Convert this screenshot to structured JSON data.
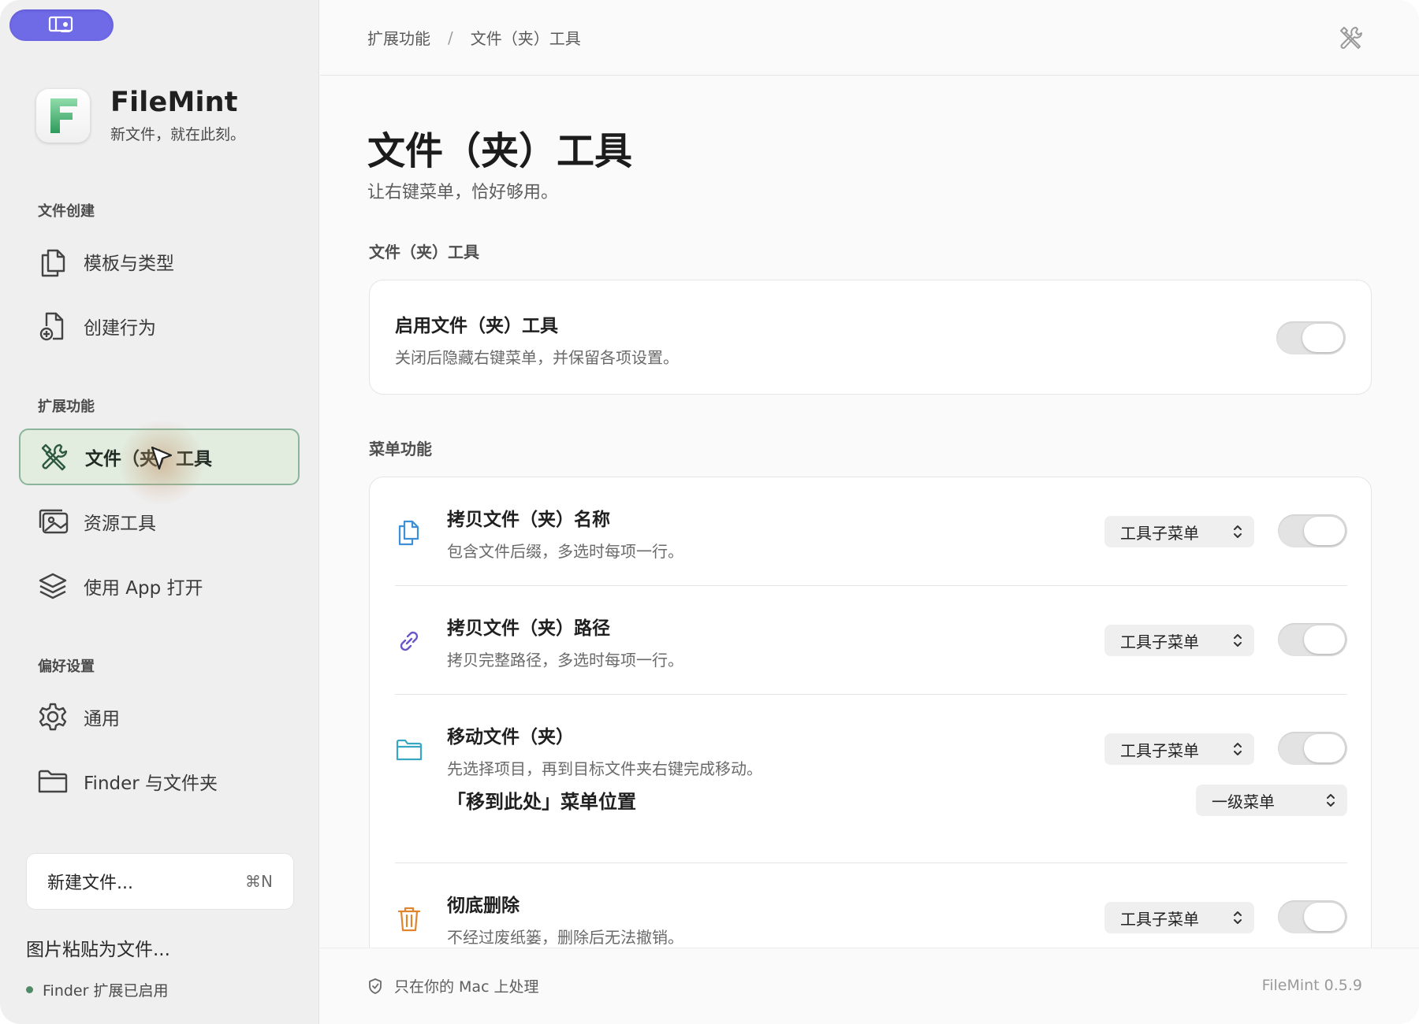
{
  "app": {
    "name": "FileMint",
    "tagline": "新文件，就在此刻。",
    "accent_color": "#6f6ae6",
    "active_color": "#8bb59a"
  },
  "sidebar": {
    "toggle_icon": "sidebar-toggle-icon",
    "sections": [
      {
        "label": "文件创建",
        "items": [
          {
            "label": "模板与类型",
            "icon": "files-icon"
          },
          {
            "label": "创建行为",
            "icon": "file-plus-icon"
          }
        ]
      },
      {
        "label": "扩展功能",
        "items": [
          {
            "label": "文件（夹）工具",
            "icon": "tools-icon",
            "active": true
          },
          {
            "label": "资源工具",
            "icon": "images-icon"
          },
          {
            "label": "使用 App 打开",
            "icon": "layers-icon"
          }
        ]
      },
      {
        "label": "偏好设置",
        "items": [
          {
            "label": "通用",
            "icon": "gear-icon"
          },
          {
            "label": "Finder 与文件夹",
            "icon": "folder-icon"
          }
        ]
      }
    ],
    "new_file": {
      "label": "新建文件...",
      "shortcut": "⌘N"
    },
    "paste_image": "图片粘贴为文件...",
    "status": "Finder 扩展已启用"
  },
  "breadcrumb": [
    "扩展功能",
    "文件（夹）工具"
  ],
  "breadcrumb_sep": "/",
  "page": {
    "title": "文件（夹）工具",
    "subtitle": "让右键菜单，恰好够用。"
  },
  "groups": {
    "tools": {
      "label": "文件（夹）工具",
      "enable": {
        "title": "启用文件（夹）工具",
        "desc": "关闭后隐藏右键菜单，并保留各项设置。",
        "on": false
      }
    },
    "menu": {
      "label": "菜单功能",
      "rows": [
        {
          "title": "拷贝文件（夹）名称",
          "desc": "包含文件后缀，多选时每项一行。",
          "select": "工具子菜单",
          "icon": "copy-files-icon",
          "on": false
        },
        {
          "title": "拷贝文件（夹）路径",
          "desc": "拷贝完整路径，多选时每项一行。",
          "select": "工具子菜单",
          "icon": "link-icon",
          "on": false
        },
        {
          "title": "移动文件（夹）",
          "desc": "先选择项目，再到目标文件夹右键完成移动。",
          "select": "工具子菜单",
          "icon": "folder-icon",
          "on": false
        },
        {
          "title": "彻底删除",
          "desc": "不经过废纸篓，删除后无法撤销。",
          "select": "工具子菜单",
          "icon": "trash-icon",
          "on": false
        }
      ],
      "move_position": {
        "label": "「移到此处」菜单位置",
        "select": "一级菜单"
      }
    }
  },
  "footer": {
    "privacy": "只在你的 Mac 上处理",
    "version": "FileMint 0.5.9"
  }
}
